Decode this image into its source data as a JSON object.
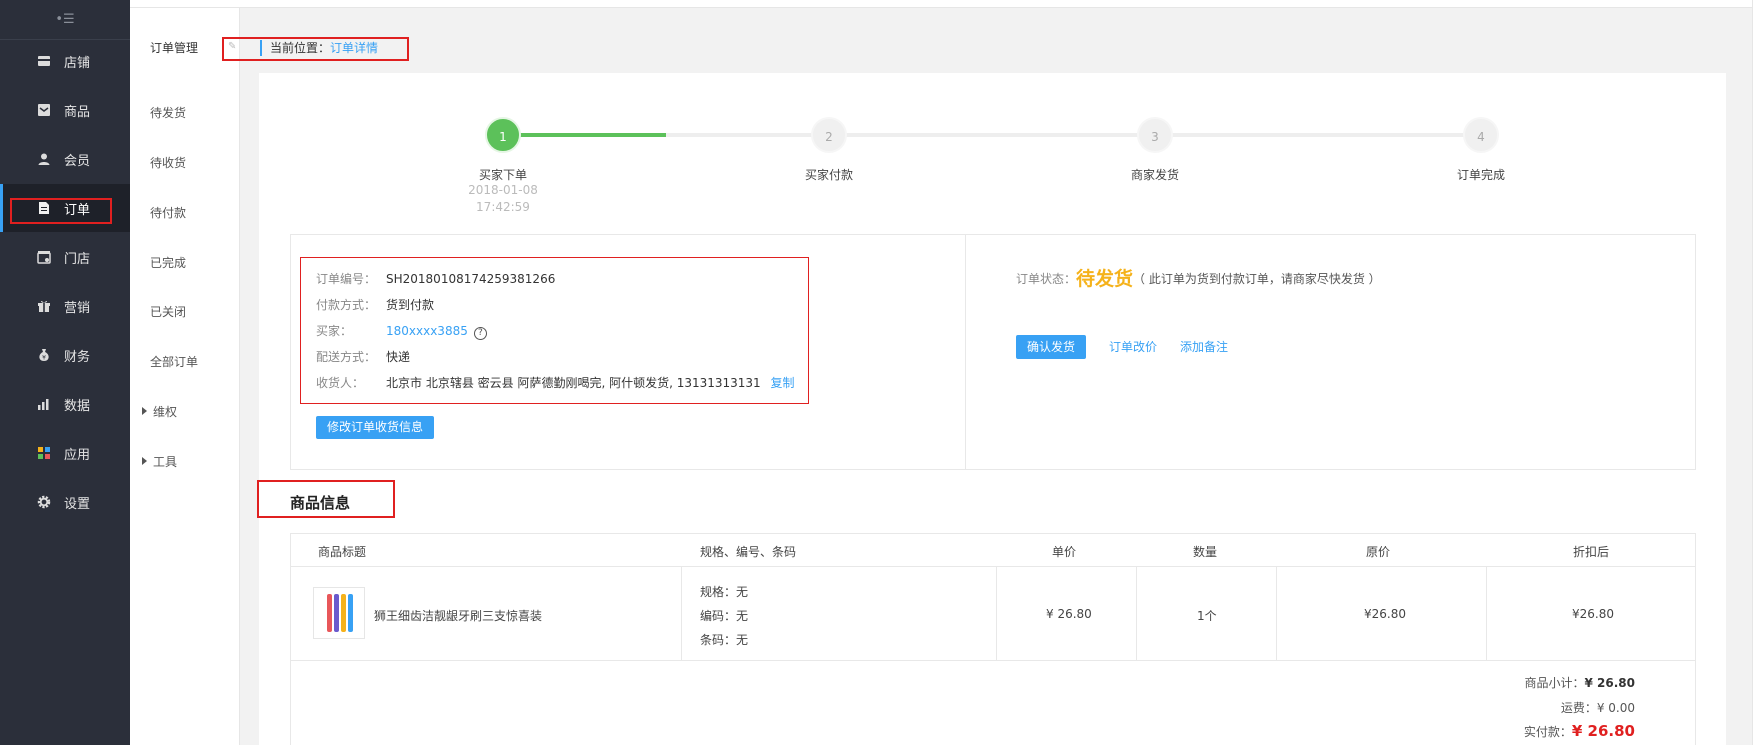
{
  "sidebar": {
    "collapse_glyph": "•☰",
    "items": [
      {
        "label": "店铺",
        "icon": "store-icon"
      },
      {
        "label": "商品",
        "icon": "goods-icon"
      },
      {
        "label": "会员",
        "icon": "member-icon"
      },
      {
        "label": "订单",
        "icon": "order-icon",
        "active": true
      },
      {
        "label": "门店",
        "icon": "shop-icon"
      },
      {
        "label": "营销",
        "icon": "gift-icon"
      },
      {
        "label": "财务",
        "icon": "money-bag-icon"
      },
      {
        "label": "数据",
        "icon": "bar-chart-icon"
      },
      {
        "label": "应用",
        "icon": "apps-icon"
      },
      {
        "label": "设置",
        "icon": "gear-icon"
      }
    ]
  },
  "subnav": {
    "title": "订单管理",
    "items": [
      "待发货",
      "待收货",
      "待付款",
      "已完成",
      "已关闭",
      "全部订单"
    ],
    "groups": [
      "维权",
      "工具"
    ]
  },
  "breadcrumb": {
    "prefix": "当前位置：",
    "current": "订单详情"
  },
  "steps": [
    {
      "num": "1",
      "label": "买家下单",
      "date": "2018-01-08",
      "time": "17:42:59",
      "done": true
    },
    {
      "num": "2",
      "label": "买家付款"
    },
    {
      "num": "3",
      "label": "商家发货"
    },
    {
      "num": "4",
      "label": "订单完成"
    }
  ],
  "order": {
    "no_label": "订单编号：",
    "no": "SH20180108174259381266",
    "pay_label": "付款方式：",
    "pay": "货到付款",
    "buyer_label": "买家：",
    "buyer": "180xxxx3885",
    "ship_label": "配送方式：",
    "ship": "快递",
    "recv_label": "收货人：",
    "recv": "北京市 北京辖县 密云县 阿萨德勤刚喝完, 阿什顿发货, 13131313131",
    "copy": "复制",
    "edit_button": "修改订单收货信息"
  },
  "status": {
    "label": "订单状态：",
    "value": "待发货",
    "note": "（ 此订单为货到付款订单，请商家尽快发货 ）",
    "confirm_button": "确认发货",
    "change_price": "订单改价",
    "add_note": "添加备注"
  },
  "products": {
    "section_title": "商品信息",
    "headers": [
      "商品标题",
      "规格、编号、条码",
      "单价",
      "数量",
      "原价",
      "折扣后"
    ],
    "rows": [
      {
        "title": "狮王细齿洁靓龈牙刷三支惊喜装",
        "spec": "规格：无",
        "code": "编码：无",
        "barcode": "条码：无",
        "price": "¥ 26.80",
        "qty": "1个",
        "orig": "¥26.80",
        "disc": "¥26.80"
      }
    ],
    "summary": {
      "subtotal_label": "商品小计：",
      "subtotal": "¥ 26.80",
      "freight_label": "运费：",
      "freight": "¥ 0.00",
      "paid_label": "实付款：",
      "paid": "¥ 26.80"
    }
  },
  "colors": {
    "accent": "#38a1f4",
    "success": "#5cc15a",
    "warning": "#f5b21b",
    "danger": "#e02020",
    "sidebar": "#2b2f3a"
  }
}
